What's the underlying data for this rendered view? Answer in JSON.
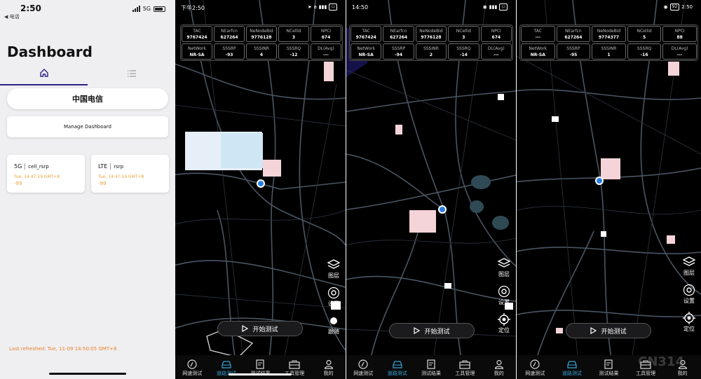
{
  "dashboard": {
    "status_time": "2:50",
    "back_label": "◀ 电话",
    "network": "5G",
    "title": "Dashboard",
    "carrier": "中国电信",
    "manage_button": "Manage Dashboard",
    "cards": [
      {
        "tech": "5G",
        "metric": "cell_rsrp",
        "time": "Tue, 14:47:19 GMT+8",
        "value": "-99"
      },
      {
        "tech": "LTE",
        "metric": "rsrp",
        "time": "Tue, 14:47:16 GMT+8",
        "value": "-99"
      }
    ],
    "refreshed": "Last refreshed: Tue, 11-09 14:50:05 GMT+8"
  },
  "labels": [
    "TAC",
    "NEarfcn",
    "NeNodeBid",
    "NCellid",
    "NPCI",
    "NetWork",
    "SSSRP",
    "SSSINR",
    "SSSRQ",
    "DL(Avg)"
  ],
  "labels_c": [
    "TAC",
    "NEarfcn",
    "NeNodeBid",
    "NCellid",
    "NPCI",
    "NetWork",
    "SSSRP",
    "SSSINR",
    "SSSRQ",
    "DL(Avg)"
  ],
  "screens": [
    {
      "time": "下午2:50",
      "battery": "",
      "values": [
        "9767424",
        "627264",
        "9776128",
        "3",
        "674",
        "NR-SA",
        "-93",
        "4",
        "-12",
        "---"
      ],
      "tools": [
        "图层",
        "设置",
        "跟随"
      ]
    },
    {
      "time": "14:50",
      "battery": "",
      "values": [
        "9767424",
        "627264",
        "9776128",
        "3",
        "674",
        "NR-SA",
        "-94",
        "2",
        "-14",
        "---"
      ],
      "tools": [
        "图层",
        "设置",
        "定位"
      ]
    },
    {
      "time": "2:50",
      "battery": "92",
      "values": [
        "---",
        "627264",
        "9774377",
        "5",
        "88",
        "NR-SA",
        "-95",
        "1",
        "-16",
        "---"
      ],
      "tools": [
        "图层",
        "设置",
        "定位"
      ]
    }
  ],
  "start_button": "开始测试",
  "nav": [
    "网速测试",
    "道路测试",
    "测试结果",
    "工具管理",
    "我的"
  ],
  "watermark": "CN314"
}
